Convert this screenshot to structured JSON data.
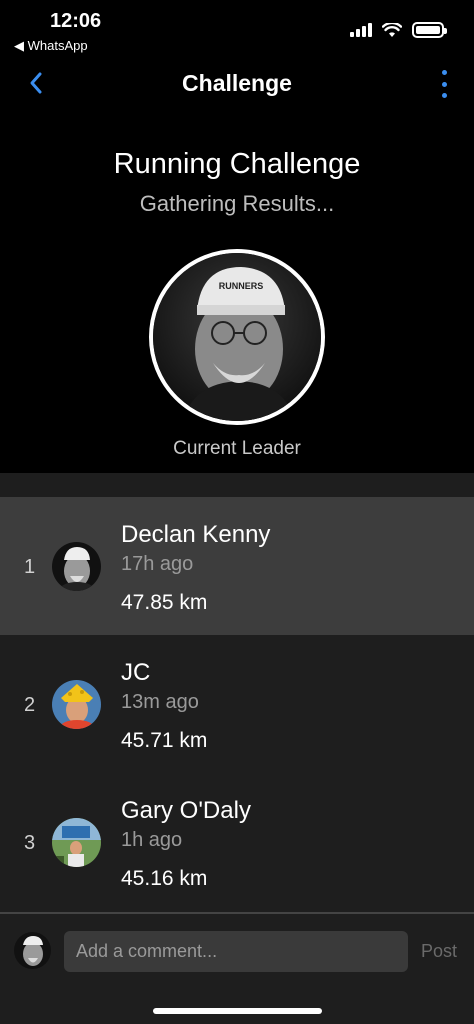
{
  "status_bar": {
    "time": "12:06",
    "back_app": "◀ WhatsApp"
  },
  "nav": {
    "title": "Challenge",
    "back_icon": "chevron-left-icon",
    "more_icon": "more-vertical-icon",
    "accent": "#3b8ef0"
  },
  "challenge": {
    "title": "Running Challenge",
    "status": "Gathering Results...",
    "leader_label": "Current Leader"
  },
  "leaderboard": [
    {
      "rank": "1",
      "name": "Declan Kenny",
      "when": "17h ago",
      "distance": "47.85 km"
    },
    {
      "rank": "2",
      "name": "JC",
      "when": "13m ago",
      "distance": "45.71 km"
    },
    {
      "rank": "3",
      "name": "Gary O'Daly",
      "when": "1h ago",
      "distance": "45.16 km"
    }
  ],
  "comment": {
    "placeholder": "Add a comment...",
    "post_label": "Post"
  }
}
